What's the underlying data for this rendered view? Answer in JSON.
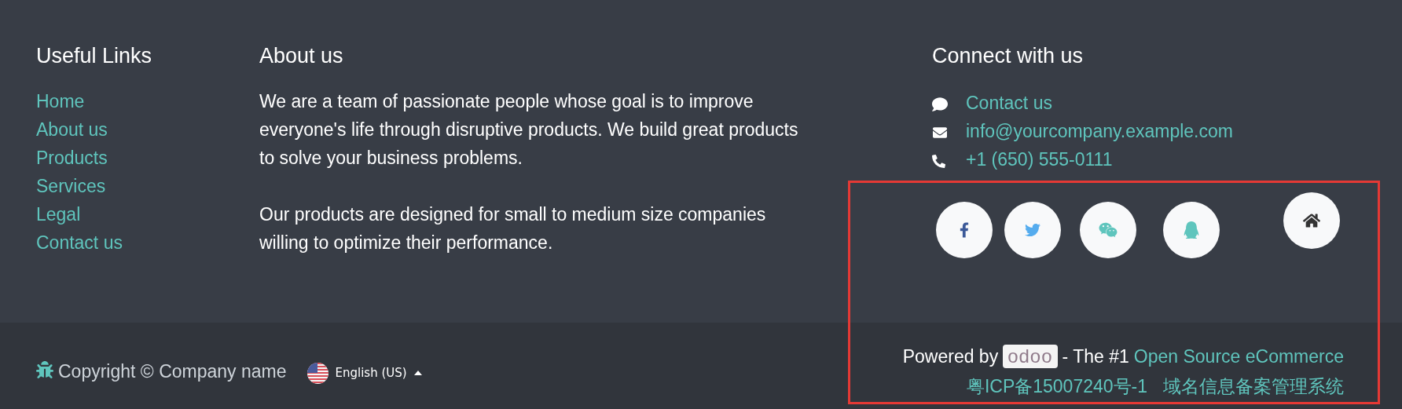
{
  "useful_links": {
    "title": "Useful Links",
    "links": [
      "Home",
      "About us",
      "Products",
      "Services",
      "Legal",
      "Contact us"
    ]
  },
  "about": {
    "title": "About us",
    "paragraphs": [
      "We are a team of passionate people whose goal is to improve everyone's life through disruptive products. We build great products to solve your business problems.",
      "Our products are designed for small to medium size companies willing to optimize their performance."
    ]
  },
  "connect": {
    "title": "Connect with us",
    "items": [
      {
        "kind": "chat",
        "text": "Contact us"
      },
      {
        "kind": "email",
        "text": "info@yourcompany.example.com"
      },
      {
        "kind": "phone",
        "text": "+1 (650) 555-0111"
      }
    ],
    "social": [
      {
        "kind": "facebook"
      },
      {
        "kind": "twitter"
      },
      {
        "kind": "wechat"
      },
      {
        "kind": "qq"
      },
      {
        "kind": "home"
      }
    ]
  },
  "bottom": {
    "copyright": "Copyright © Company name",
    "language": "English (US)",
    "powered_prefix": "Powered by",
    "logo": "odoo",
    "powered_middle": "- The #1",
    "powered_link": "Open Source eCommerce",
    "icp_links": [
      "粤ICP备15007240号-1",
      "域名信息备案管理系统"
    ]
  },
  "highlight_frame": true
}
